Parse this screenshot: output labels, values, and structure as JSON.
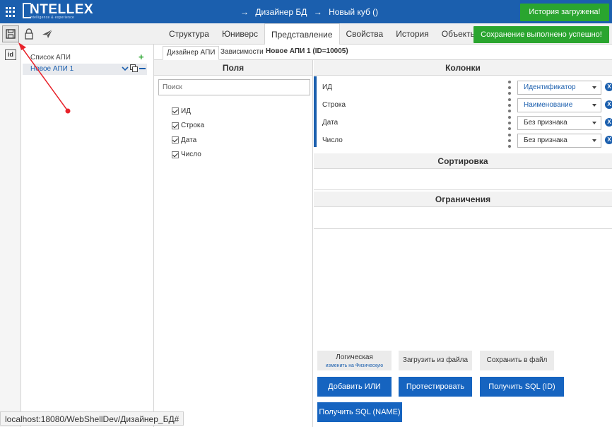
{
  "header": {
    "logo_text": "NTELLEX",
    "logo_tagline": "intelligence & experience",
    "breadcrumb": [
      "→",
      "Дизайнер БД",
      "→",
      "Новый куб ()"
    ]
  },
  "toasts": {
    "loaded": "История загружена!",
    "saved": "Сохранение выполнено успешно!"
  },
  "tabs": [
    "Структура",
    "Юниверс",
    "Представление",
    "Свойства",
    "История",
    "Объекты ку"
  ],
  "active_tab": "Представление",
  "rail": {
    "id_label": "id"
  },
  "tree": {
    "title": "Список АПИ",
    "items": [
      {
        "label": "Новое АПИ 1"
      }
    ]
  },
  "subtabs": [
    "Дизайнер АПИ",
    "Зависимости"
  ],
  "api_title": "Новое АПИ 1 (ID=10005)",
  "fields": {
    "header": "Поля",
    "search_placeholder": "Поиск",
    "items": [
      "ИД",
      "Строка",
      "Дата",
      "Число"
    ]
  },
  "columns": {
    "header": "Колонки",
    "rows": [
      {
        "name": "ИД",
        "attribute": "Идентификатор"
      },
      {
        "name": "Строка",
        "attribute": "Наименование"
      },
      {
        "name": "Дата",
        "attribute": "Без признака"
      },
      {
        "name": "Число",
        "attribute": "Без признака"
      }
    ]
  },
  "sorting": {
    "header": "Сортировка"
  },
  "constraints": {
    "header": "Ограничения"
  },
  "buttons": {
    "logical": "Логическая",
    "logical_sub": "изменить на Физическую",
    "load_file": "Загрузить из файла",
    "save_file": "Сохранить в файл",
    "add_or": "Добавить ИЛИ",
    "test": "Протестировать",
    "get_sql_id": "Получить SQL (ID)",
    "get_sql_name": "Получить SQL (NAME)"
  },
  "status_url": "localhost:18080/WebShellDev/Дизайнер_БД#",
  "colors": {
    "brand": "#1b5fae",
    "success": "#2aa52f",
    "button": "#1664c0",
    "annotation": "#e8232b"
  },
  "icons": [
    "grid-menu-icon",
    "save-icon",
    "lock-icon",
    "send-icon",
    "add-icon",
    "chevron-down-icon",
    "copy-icon",
    "minus-icon",
    "remove-icon",
    "drag-handle-icon"
  ]
}
